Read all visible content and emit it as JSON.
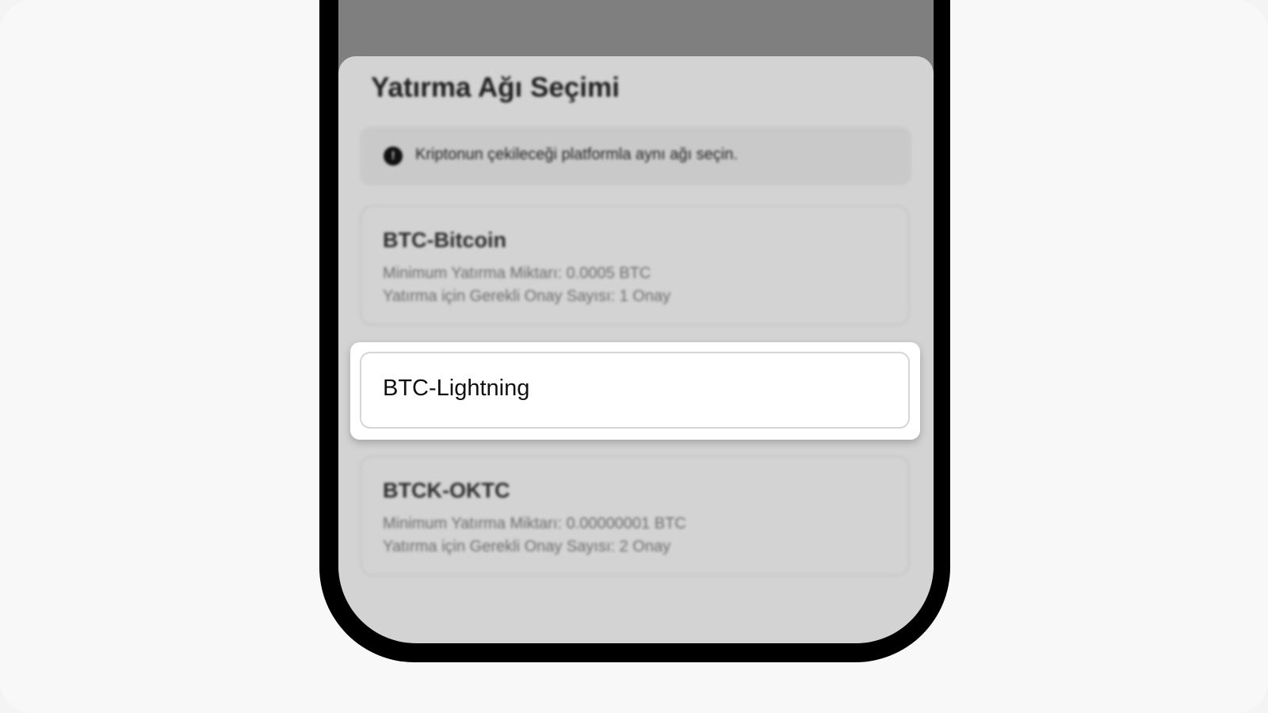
{
  "sheet": {
    "title": "Yatırma Ağı Seçimi",
    "notice": {
      "icon": "info-icon",
      "icon_glyph": "!",
      "text": "Kriptonun çekileceği platformla aynı ağı seçin."
    }
  },
  "networks": [
    {
      "name": "BTC-Bitcoin",
      "min_deposit": "Minimum Yatırma Miktarı: 0.0005 BTC",
      "confirmations": "Yatırma için Gerekli Onay Sayısı: 1 Onay"
    },
    {
      "name": "BTC-Lightning",
      "highlighted": true
    },
    {
      "name": "BTCK-OKTC",
      "min_deposit": "Minimum Yatırma Miktarı: 0.00000001 BTC",
      "confirmations": "Yatırma için Gerekli Onay Sayısı: 2 Onay"
    }
  ],
  "colors": {
    "sheet_background": "#d3d3d3",
    "dimmed_overlay": "#7f7f7f",
    "highlight_background": "#ffffff",
    "phone_frame": "#000000"
  }
}
